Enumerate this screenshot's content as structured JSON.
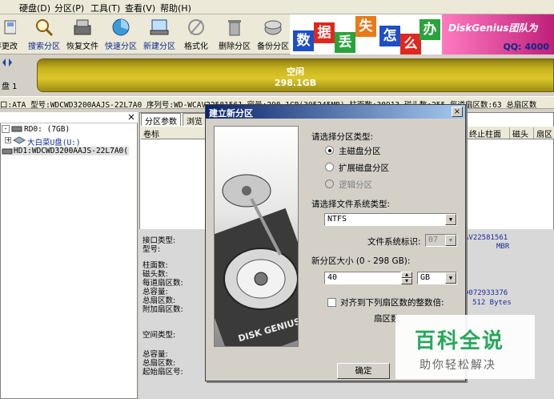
{
  "menu": [
    "硬盘(D)",
    "分区(P)",
    "工具(T)",
    "查看(V)",
    "帮助(H)"
  ],
  "toolbar": [
    {
      "label": "存更改",
      "icon": "save-icon"
    },
    {
      "label": "搜索分区",
      "icon": "search-icon"
    },
    {
      "label": "恢复文件",
      "icon": "recover-files-icon"
    },
    {
      "label": "快速分区",
      "icon": "quick-partition-icon"
    },
    {
      "label": "新建分区",
      "icon": "new-partition-icon"
    },
    {
      "label": "格式化",
      "icon": "format-icon"
    },
    {
      "label": "删除分区",
      "icon": "delete-icon"
    },
    {
      "label": "备份分区",
      "icon": "backup-icon"
    }
  ],
  "banner": {
    "tiles": [
      "数",
      "据",
      "丢",
      "失",
      "怎",
      "么",
      "办"
    ],
    "tile_colors": [
      "#1f4fc6",
      "#e0281e",
      "#2aa33c",
      "#e87a1a",
      "#1f4fc6",
      "#e0281e",
      "#2aa33c"
    ],
    "brand": "DiskGenius团队为",
    "qq": "QQ: 4000"
  },
  "disk_map": {
    "disk_label": "盘 1",
    "partition_label": "空闲",
    "partition_size": "298.1GB"
  },
  "disk_info": "口:ATA  型号:WDCWD3200AAJS-22L7A0  序列号:WD-WCAV22581561  容量:298.1GB(305245MB)  柱面数:38913  磁头数:255  每道扇区数:63  总扇区数",
  "tree": {
    "items": [
      {
        "label": "RD0: (7GB)"
      },
      {
        "label": "大白菜U盘(U:)"
      },
      {
        "label": "HD1:WDCWD3200AAJS-22L7A0("
      }
    ]
  },
  "tabs": [
    "分区参数",
    "浏览"
  ],
  "columns": {
    "left": "卷标",
    "right": [
      "终止柱面",
      "磁头",
      "扇区"
    ]
  },
  "props": {
    "labels": [
      "接口类型:",
      "型号:",
      "柱面数:",
      "磁头数:",
      "每道扇区数:",
      "总容量:",
      "总扇区数:",
      "附加扇区数:",
      "空间类型:",
      "总容量:",
      "总扇区数:",
      "起始扇区号:"
    ],
    "values": [
      "AV22581561",
      "MBR",
      "0072933376",
      "512 Bytes"
    ]
  },
  "dialog": {
    "title": "建立新分区",
    "close": "×",
    "type_prompt": "请选择分区类型:",
    "types": [
      {
        "label": "主磁盘分区",
        "selected": true,
        "disabled": false
      },
      {
        "label": "扩展磁盘分区",
        "selected": false,
        "disabled": false
      },
      {
        "label": "逻辑分区",
        "selected": false,
        "disabled": true
      }
    ],
    "fs_prompt": "请选择文件系统类型:",
    "fs_value": "NTFS",
    "fs_id_label": "文件系统标识:",
    "fs_id_value": "07",
    "size_label": "新分区大小 (0 - 298 GB):",
    "size_value": "40",
    "size_unit": "GB",
    "align_label": "对齐到下列扇区数的整数倍:",
    "sector_label": "扇区数",
    "ok_label": "确定",
    "brand_image": "DISK GENIUS"
  },
  "watermark": {
    "title": "百科全说",
    "subtitle": "助你轻松解决"
  }
}
